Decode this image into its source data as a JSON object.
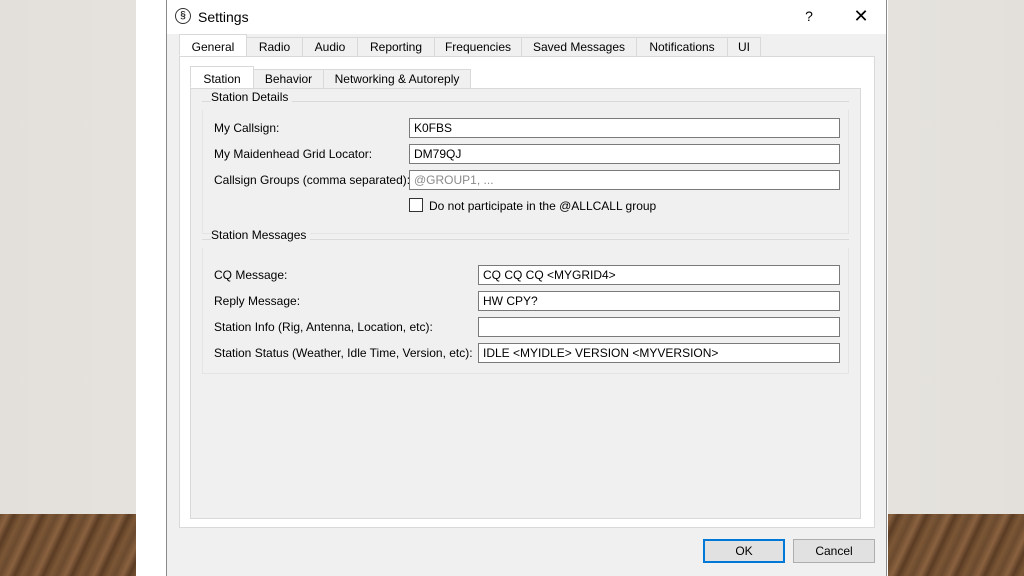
{
  "window": {
    "title": "Settings",
    "help_glyph": "?",
    "close_glyph": "✕"
  },
  "outer_tabs": [
    {
      "label": "General",
      "active": true
    },
    {
      "label": "Radio",
      "active": false
    },
    {
      "label": "Audio",
      "active": false
    },
    {
      "label": "Reporting",
      "active": false
    },
    {
      "label": "Frequencies",
      "active": false
    },
    {
      "label": "Saved Messages",
      "active": false
    },
    {
      "label": "Notifications",
      "active": false
    },
    {
      "label": "UI",
      "active": false
    }
  ],
  "inner_tabs": [
    {
      "label": "Station",
      "active": true
    },
    {
      "label": "Behavior",
      "active": false
    },
    {
      "label": "Networking & Autoreply",
      "active": false
    }
  ],
  "station_details": {
    "title": "Station Details",
    "callsign_label": "My Callsign:",
    "callsign_value": "K0FBS",
    "grid_label": "My Maidenhead Grid Locator:",
    "grid_value": "DM79QJ",
    "groups_label": "Callsign Groups (comma separated):",
    "groups_value": "",
    "groups_placeholder": "@GROUP1, ...",
    "allcall_label": "Do not participate in the @ALLCALL group",
    "allcall_checked": false
  },
  "station_messages": {
    "title": "Station Messages",
    "cq_label": "CQ Message:",
    "cq_value": "CQ CQ CQ <MYGRID4>",
    "reply_label": "Reply Message:",
    "reply_value": "HW CPY?",
    "info_label": "Station Info (Rig, Antenna, Location, etc):",
    "info_value": "",
    "status_label": "Station Status (Weather, Idle Time, Version, etc):",
    "status_value": "IDLE <MYIDLE> VERSION <MYVERSION>"
  },
  "buttons": {
    "ok": "OK",
    "cancel": "Cancel"
  }
}
